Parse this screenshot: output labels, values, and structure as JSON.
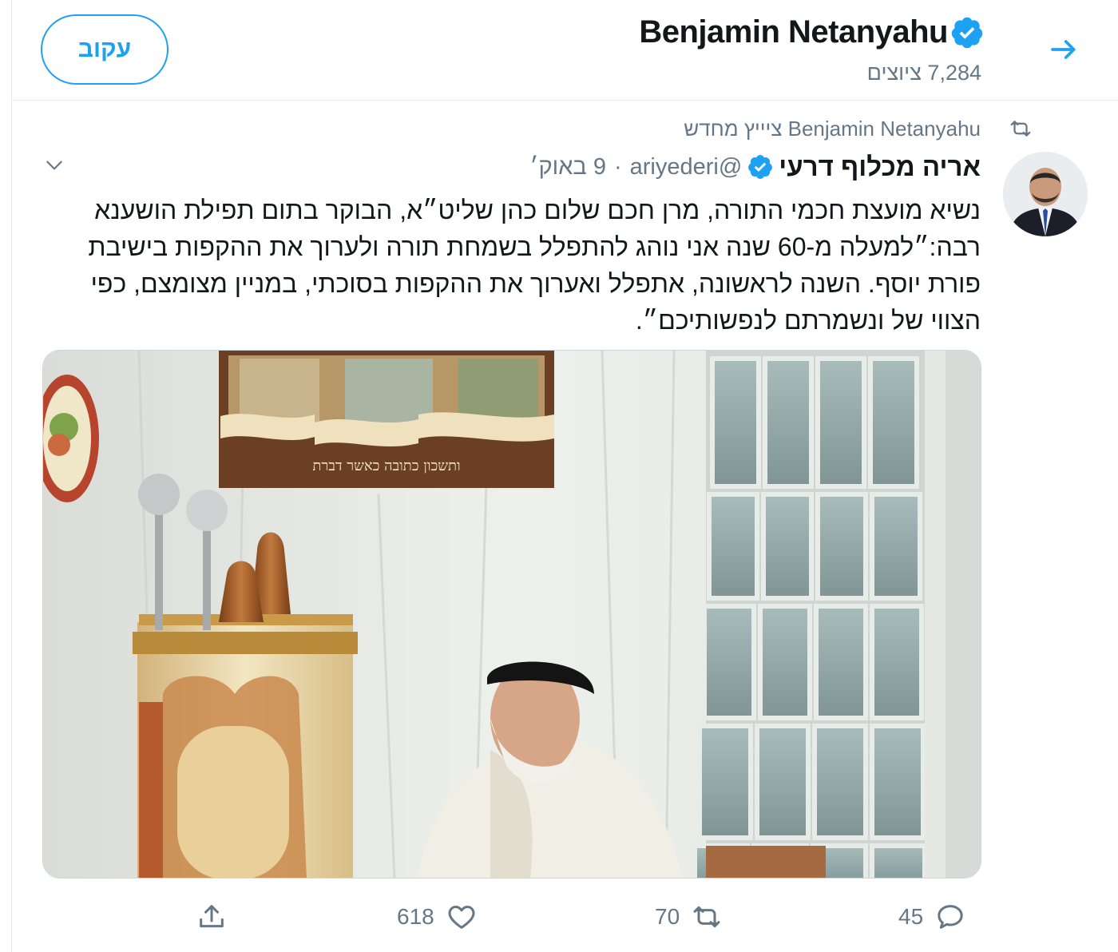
{
  "header": {
    "name": "Benjamin Netanyahu",
    "tweet_count": "7,284 ציוצים",
    "follow_label": "עקוב",
    "back_icon": "arrow-right-icon"
  },
  "tweet": {
    "retweet_context": "Benjamin Netanyahu ציייץ מחדש",
    "author_name": "אריה מכלוף דרעי",
    "handle": "@ariyederi",
    "separator": "·",
    "date": "9 באוק׳",
    "text": "נשיא מועצת חכמי התורה, מרן חכם שלום כהן שליט״א, הבוקר בתום תפילת הושענא רבה:״למעלה מ-60 שנה אני נוהג להתפלל בשמחת תורה ולערוך את ההקפות בישיבת פורת יוסף. השנה לראשונה, אתפלל ואערוך את ההקפות בסוכתי, במניין מצומצם, כפי הצווי של ונשמרתם לנפשותיכם״.",
    "media_sign_text": "ותשכון כתובה כאשר דברת",
    "actions": {
      "reply_count": "45",
      "retweet_count": "70",
      "like_count": "618"
    }
  },
  "colors": {
    "accent": "#1da1f2",
    "text_primary": "#14171a",
    "text_secondary": "#657786",
    "border": "#e6ecf0"
  }
}
